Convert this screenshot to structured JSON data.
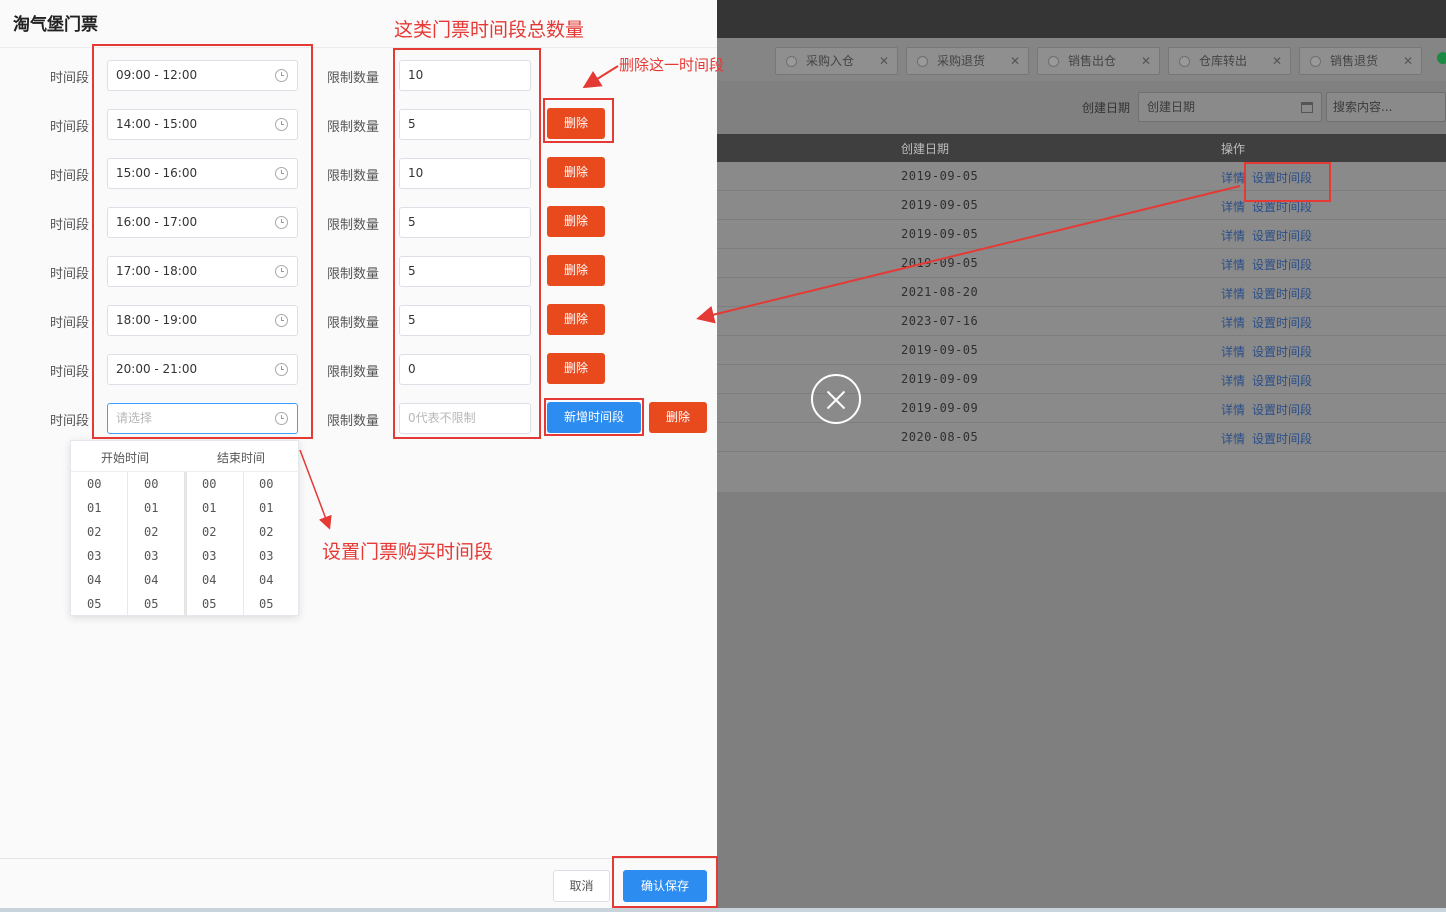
{
  "background": {
    "tabs": [
      {
        "label": "采购入仓"
      },
      {
        "label": "采购退货"
      },
      {
        "label": "销售出仓"
      },
      {
        "label": "仓库转出"
      },
      {
        "label": "销售退货"
      }
    ],
    "filter": {
      "label": "创建日期",
      "date_placeholder": "创建日期",
      "search_placeholder": "搜索内容..."
    },
    "table": {
      "headers": {
        "date": "创建日期",
        "ops": "操作"
      },
      "rows": [
        {
          "date": "2019-09-05",
          "detail": "详情",
          "set_time": "设置时间段"
        },
        {
          "date": "2019-09-05",
          "detail": "详情",
          "set_time": "设置时间段"
        },
        {
          "date": "2019-09-05",
          "detail": "详情",
          "set_time": "设置时间段"
        },
        {
          "date": "2019-09-05",
          "detail": "详情",
          "set_time": "设置时间段"
        },
        {
          "date": "2021-08-20",
          "detail": "详情",
          "set_time": "设置时间段"
        },
        {
          "date": "2023-07-16",
          "detail": "详情",
          "set_time": "设置时间段"
        },
        {
          "date": "2019-09-05",
          "detail": "详情",
          "set_time": "设置时间段"
        },
        {
          "date": "2019-09-09",
          "detail": "详情",
          "set_time": "设置时间段"
        },
        {
          "date": "2019-09-09",
          "detail": "详情",
          "set_time": "设置时间段"
        },
        {
          "date": "2020-08-05",
          "detail": "详情",
          "set_time": "设置时间段"
        }
      ]
    }
  },
  "drawer": {
    "title": "淘气堡门票",
    "time_label": "时间段",
    "limit_label": "限制数量",
    "delete_label": "删除",
    "rows": [
      {
        "time": "09:00 - 12:00",
        "limit": "10"
      },
      {
        "time": "14:00 - 15:00",
        "limit": "5"
      },
      {
        "time": "15:00 - 16:00",
        "limit": "10"
      },
      {
        "time": "16:00 - 17:00",
        "limit": "5"
      },
      {
        "time": "17:00 - 18:00",
        "limit": "5"
      },
      {
        "time": "18:00 - 19:00",
        "limit": "5"
      },
      {
        "time": "20:00 - 21:00",
        "limit": "0"
      }
    ],
    "new_row": {
      "time_placeholder": "请选择",
      "limit_placeholder": "0代表不限制",
      "add_label": "新增时间段"
    },
    "picker": {
      "start_label": "开始时间",
      "end_label": "结束时间",
      "values": [
        "00",
        "01",
        "02",
        "03",
        "04",
        "05"
      ]
    },
    "footer": {
      "cancel_label": "取消",
      "save_label": "确认保存"
    }
  },
  "annotations": {
    "total_qty": "这类门票时间段总数量",
    "delete_this": "删除这一时间段",
    "set_period": "设置门票购买时间段"
  },
  "colors": {
    "annotation": "#e53935",
    "primary": "#2d8cf0",
    "danger": "#e8491d"
  }
}
